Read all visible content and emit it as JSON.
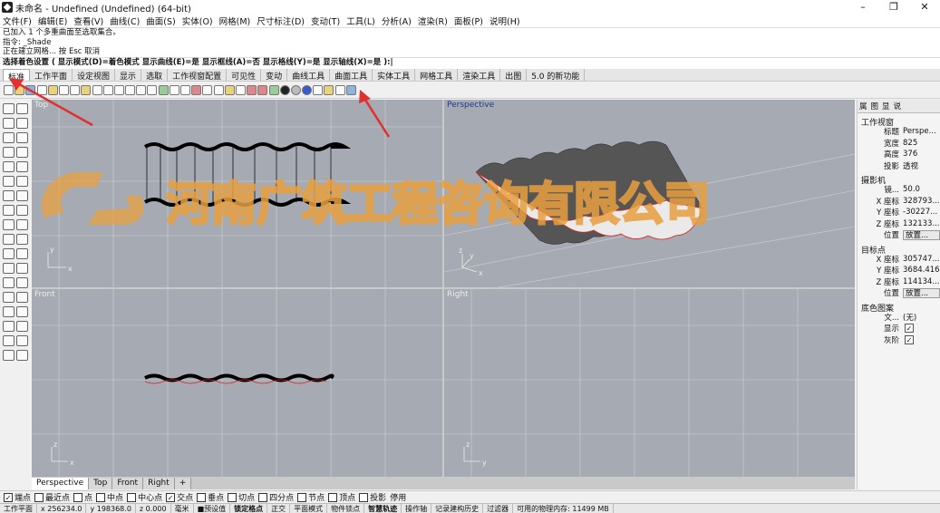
{
  "window": {
    "title": "未命名 - Undefined (Undefined) (64-bit)",
    "minimize": "–",
    "maximize": "❐",
    "close": "✕"
  },
  "menu": [
    "文件(F)",
    "编辑(E)",
    "查看(V)",
    "曲线(C)",
    "曲面(S)",
    "实体(O)",
    "网格(M)",
    "尺寸标注(D)",
    "变动(T)",
    "工具(L)",
    "分析(A)",
    "渲染(R)",
    "面板(P)",
    "说明(H)"
  ],
  "command": {
    "line1": "已加入 1 个多重曲面至选取集合。",
    "line2": "指令: _Shade",
    "line3": "正在建立网格... 按 Esc 取消",
    "prompt": "选择着色设置 ( 显示模式(D)=着色模式  显示曲线(E)=是  显示框线(A)=否  显示格线(Y)=是  显示轴线(X)=是 ):|"
  },
  "tabs": [
    "标准",
    "工作平面",
    "设定视图",
    "显示",
    "选取",
    "工作视窗配置",
    "可见性",
    "变动",
    "曲线工具",
    "曲面工具",
    "实体工具",
    "网格工具",
    "渲染工具",
    "出图",
    "5.0 的新功能"
  ],
  "viewports": {
    "top": "Top",
    "perspective": "Perspective",
    "front": "Front",
    "right": "Right"
  },
  "axis": {
    "x": "x",
    "y": "y",
    "z": "z"
  },
  "watermark": "河南广筑工程咨询有限公司",
  "right_panel": {
    "tabs": [
      "属",
      "图",
      "显",
      "说"
    ],
    "section1": "工作视窗",
    "rows1": [
      [
        "标题",
        "Perspe..."
      ],
      [
        "宽度",
        "825"
      ],
      [
        "高度",
        "376"
      ],
      [
        "投影",
        "透视"
      ]
    ],
    "section2": "摄影机",
    "rows2": [
      [
        "镜...",
        "50.0"
      ],
      [
        "X 座标",
        "328793..."
      ],
      [
        "Y 座标",
        "-30227..."
      ],
      [
        "Z 座标",
        "132133..."
      ]
    ],
    "place1_label": "位置",
    "place_btn": "放置...",
    "section3": "目标点",
    "rows3": [
      [
        "X 座标",
        "305747..."
      ],
      [
        "Y 座标",
        "3684.416"
      ],
      [
        "Z 座标",
        "114134..."
      ]
    ],
    "place2_label": "位置",
    "place_btn2": "放置...",
    "section4": "底色图案",
    "file_label": "文...",
    "file_val": "(无)",
    "show_label": "显示",
    "gray_label": "灰阶"
  },
  "view_tabs": [
    "Perspective",
    "Top",
    "Front",
    "Right",
    "+"
  ],
  "osnap": [
    [
      "端点",
      true
    ],
    [
      "最近点",
      false
    ],
    [
      "点",
      false
    ],
    [
      "中点",
      false
    ],
    [
      "中心点",
      false
    ],
    [
      "交点",
      true
    ],
    [
      "垂点",
      false
    ],
    [
      "切点",
      false
    ],
    [
      "四分点",
      false
    ],
    [
      "节点",
      false
    ],
    [
      "顶点",
      false
    ],
    [
      "投影",
      false
    ],
    [
      "停用",
      null
    ]
  ],
  "status": [
    "工作平面",
    "x 256234.0",
    "y 198368.0",
    "z 0.000",
    "毫米",
    "■预设值",
    "锁定格点",
    "正交",
    "平面模式",
    "物件锁点",
    "智慧轨迹",
    "操作轴",
    "记录建构历史",
    "过滤器",
    "可用的物理内存: 11499 MB"
  ],
  "colors": {
    "accent": "#e03030",
    "viewport": "#a6aab2",
    "watermark": "#e8a040"
  }
}
